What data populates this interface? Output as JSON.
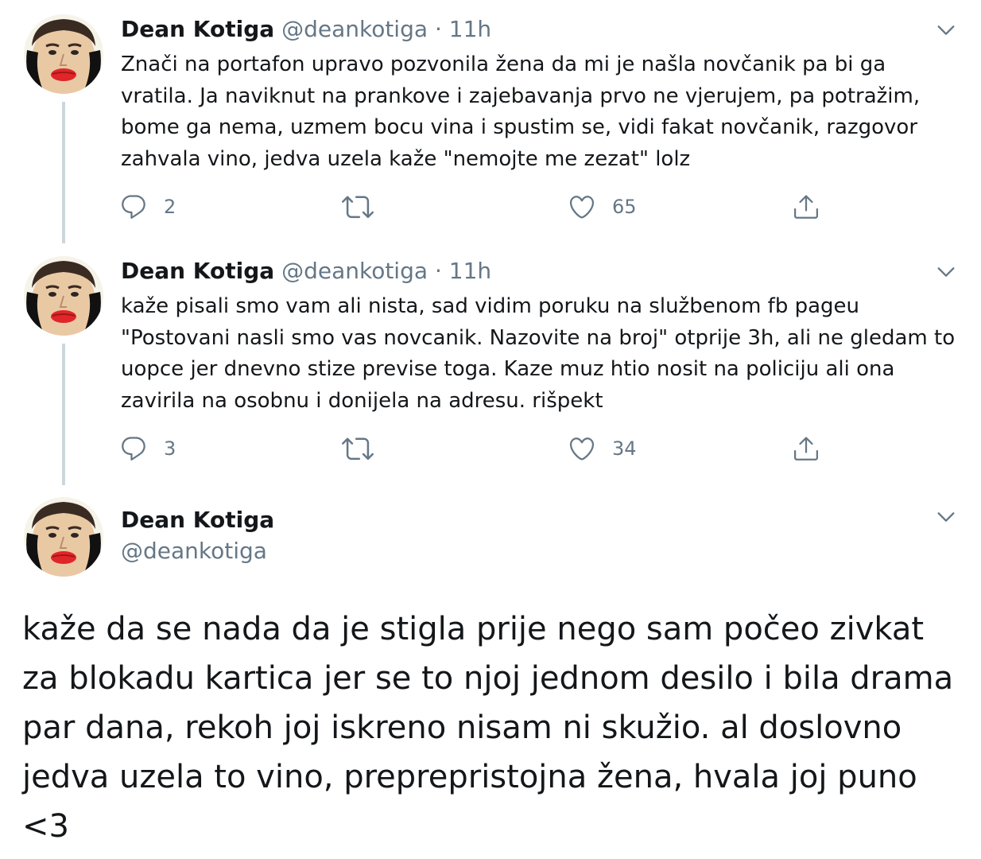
{
  "tweets": [
    {
      "name": "Dean Kotiga",
      "handle": "@deankotiga",
      "separator": "·",
      "time": "11h",
      "text": "Znači na portafon upravo pozvonila žena da mi je našla novčanik pa bi ga vratila. Ja naviknut na prankove i zajebavanja prvo ne vjerujem, pa potražim, bome ga nema, uzmem bocu vina i spustim se, vidi fakat novčanik, razgovor zahvala vino, jedva uzela kaže \"nemojte me zezat\" lolz",
      "replies": "2",
      "likes": "65"
    },
    {
      "name": "Dean Kotiga",
      "handle": "@deankotiga",
      "separator": "·",
      "time": "11h",
      "text": "kaže pisali smo vam ali nista, sad vidim poruku na službenom fb pageu \"Postovani nasli smo vas novcanik. Nazovite na broj\" otprije 3h, ali ne gledam to uopce jer dnevno stize previse toga. Kaze muz htio nosit na policiju ali ona zavirila na osobnu i donijela na adresu. rišpekt",
      "replies": "3",
      "likes": "34"
    }
  ],
  "main_tweet": {
    "name": "Dean Kotiga",
    "handle": "@deankotiga",
    "text": "kaže da se nada da je stigla prije nego sam počeo zivkat za blokadu kartica jer se to njoj jednom desilo i bila drama par dana, rekoh joj iskreno nisam ni skužio. al doslovno jedva uzela to vino, preprepristojna žena, hvala joj puno <3"
  },
  "icons": {
    "reply": "reply-icon",
    "retweet": "retweet-icon",
    "like": "heart-icon",
    "share": "share-icon",
    "caret": "chevron-down-icon"
  },
  "colors": {
    "text": "#14171a",
    "secondary": "#657786",
    "thread_line": "#ccd6dd"
  }
}
